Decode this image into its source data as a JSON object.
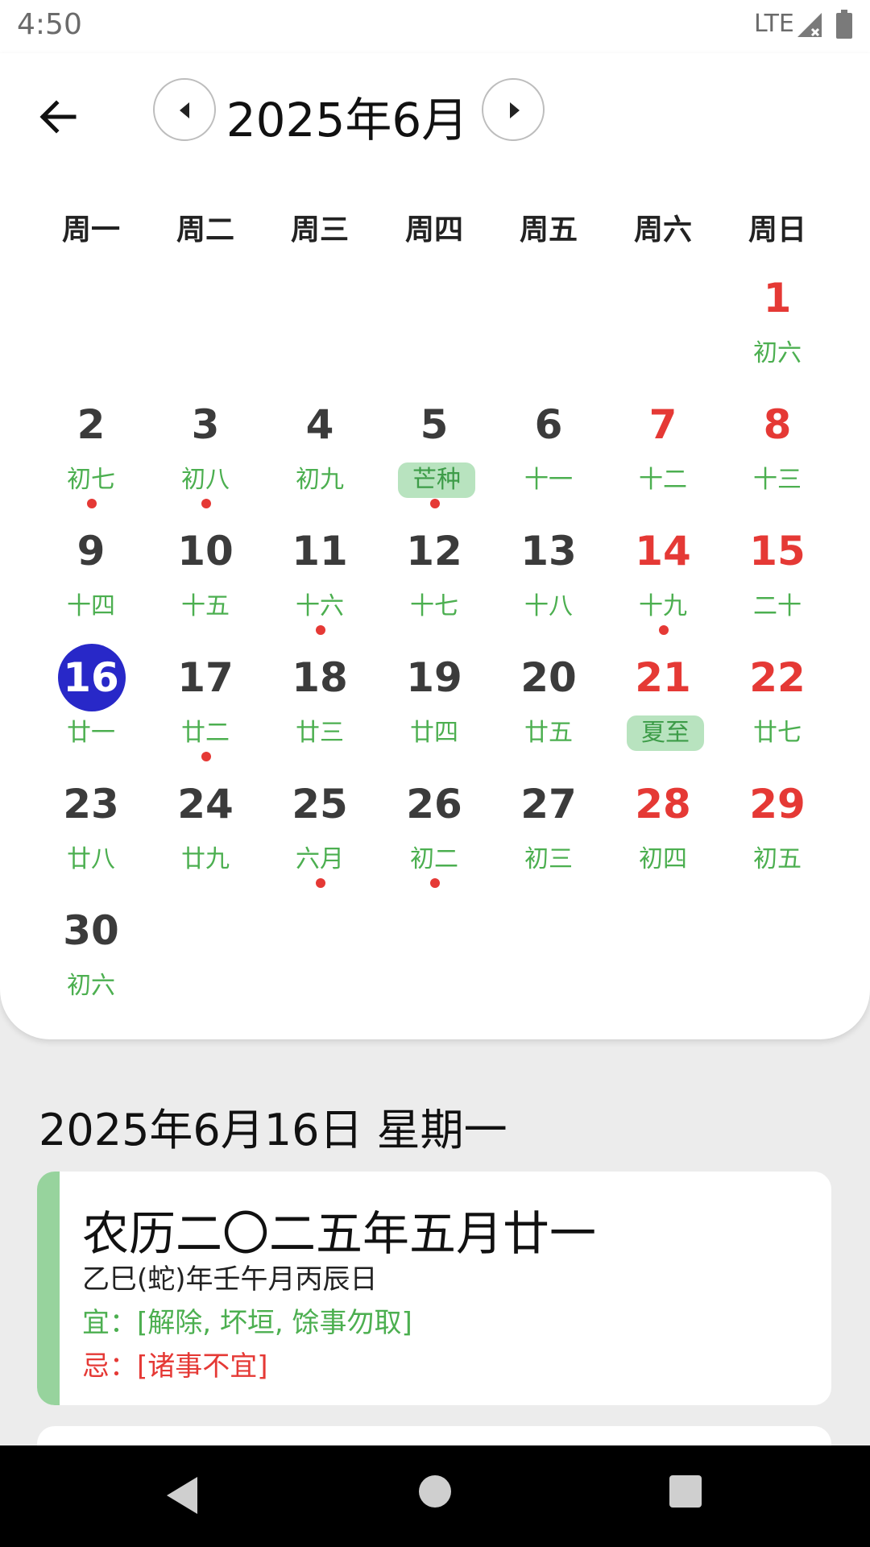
{
  "status_bar": {
    "time": "4:50",
    "network": "LTE",
    "icons": [
      "signal-no-data-icon",
      "battery-icon"
    ]
  },
  "header": {
    "back_icon": "arrow-left-icon",
    "prev_icon": "caret-left-icon",
    "next_icon": "caret-right-icon",
    "month_title": "2025年6月"
  },
  "weekdays": [
    "周一",
    "周二",
    "周三",
    "周四",
    "周五",
    "周六",
    "周日"
  ],
  "calendar": {
    "selected_day": 16,
    "colors": {
      "weekend": "#e53935",
      "weekday": "#3b3b3b",
      "lunar": "#4caf50",
      "selected_bg": "#2828c8",
      "solar_term_bg": "#b8e3bf",
      "event_dot": "#e53935"
    },
    "days": [
      {
        "day": "1",
        "lunar": "初六",
        "weekend": true,
        "term": false,
        "dot": false
      },
      {
        "day": "2",
        "lunar": "初七",
        "weekend": false,
        "term": false,
        "dot": true
      },
      {
        "day": "3",
        "lunar": "初八",
        "weekend": false,
        "term": false,
        "dot": true
      },
      {
        "day": "4",
        "lunar": "初九",
        "weekend": false,
        "term": false,
        "dot": false
      },
      {
        "day": "5",
        "lunar": "芒种",
        "weekend": false,
        "term": true,
        "dot": true
      },
      {
        "day": "6",
        "lunar": "十一",
        "weekend": false,
        "term": false,
        "dot": false
      },
      {
        "day": "7",
        "lunar": "十二",
        "weekend": true,
        "term": false,
        "dot": false
      },
      {
        "day": "8",
        "lunar": "十三",
        "weekend": true,
        "term": false,
        "dot": false
      },
      {
        "day": "9",
        "lunar": "十四",
        "weekend": false,
        "term": false,
        "dot": false
      },
      {
        "day": "10",
        "lunar": "十五",
        "weekend": false,
        "term": false,
        "dot": false
      },
      {
        "day": "11",
        "lunar": "十六",
        "weekend": false,
        "term": false,
        "dot": true
      },
      {
        "day": "12",
        "lunar": "十七",
        "weekend": false,
        "term": false,
        "dot": false
      },
      {
        "day": "13",
        "lunar": "十八",
        "weekend": false,
        "term": false,
        "dot": false
      },
      {
        "day": "14",
        "lunar": "十九",
        "weekend": true,
        "term": false,
        "dot": true
      },
      {
        "day": "15",
        "lunar": "二十",
        "weekend": true,
        "term": false,
        "dot": false
      },
      {
        "day": "16",
        "lunar": "廿一",
        "weekend": false,
        "term": false,
        "dot": false
      },
      {
        "day": "17",
        "lunar": "廿二",
        "weekend": false,
        "term": false,
        "dot": true
      },
      {
        "day": "18",
        "lunar": "廿三",
        "weekend": false,
        "term": false,
        "dot": false
      },
      {
        "day": "19",
        "lunar": "廿四",
        "weekend": false,
        "term": false,
        "dot": false
      },
      {
        "day": "20",
        "lunar": "廿五",
        "weekend": false,
        "term": false,
        "dot": false
      },
      {
        "day": "21",
        "lunar": "夏至",
        "weekend": true,
        "term": true,
        "dot": false
      },
      {
        "day": "22",
        "lunar": "廿七",
        "weekend": true,
        "term": false,
        "dot": false
      },
      {
        "day": "23",
        "lunar": "廿八",
        "weekend": false,
        "term": false,
        "dot": false
      },
      {
        "day": "24",
        "lunar": "廿九",
        "weekend": false,
        "term": false,
        "dot": false
      },
      {
        "day": "25",
        "lunar": "六月",
        "weekend": false,
        "term": false,
        "dot": true
      },
      {
        "day": "26",
        "lunar": "初二",
        "weekend": false,
        "term": false,
        "dot": true
      },
      {
        "day": "27",
        "lunar": "初三",
        "weekend": false,
        "term": false,
        "dot": false
      },
      {
        "day": "28",
        "lunar": "初四",
        "weekend": true,
        "term": false,
        "dot": false
      },
      {
        "day": "29",
        "lunar": "初五",
        "weekend": true,
        "term": false,
        "dot": false
      },
      {
        "day": "30",
        "lunar": "初六",
        "weekend": false,
        "term": false,
        "dot": false
      }
    ]
  },
  "detail": {
    "date_line": "2025年6月16日 星期一",
    "lunar_full": "农历二〇二五年五月廿一",
    "ganzhi": "乙巳(蛇)年壬午月丙辰日",
    "yi": "宜：[解除, 坏垣, 馀事勿取]",
    "ji": "忌：[诸事不宜]"
  },
  "nav_bar": {
    "icons": [
      "back-triangle-icon",
      "home-circle-icon",
      "recents-square-icon"
    ]
  }
}
